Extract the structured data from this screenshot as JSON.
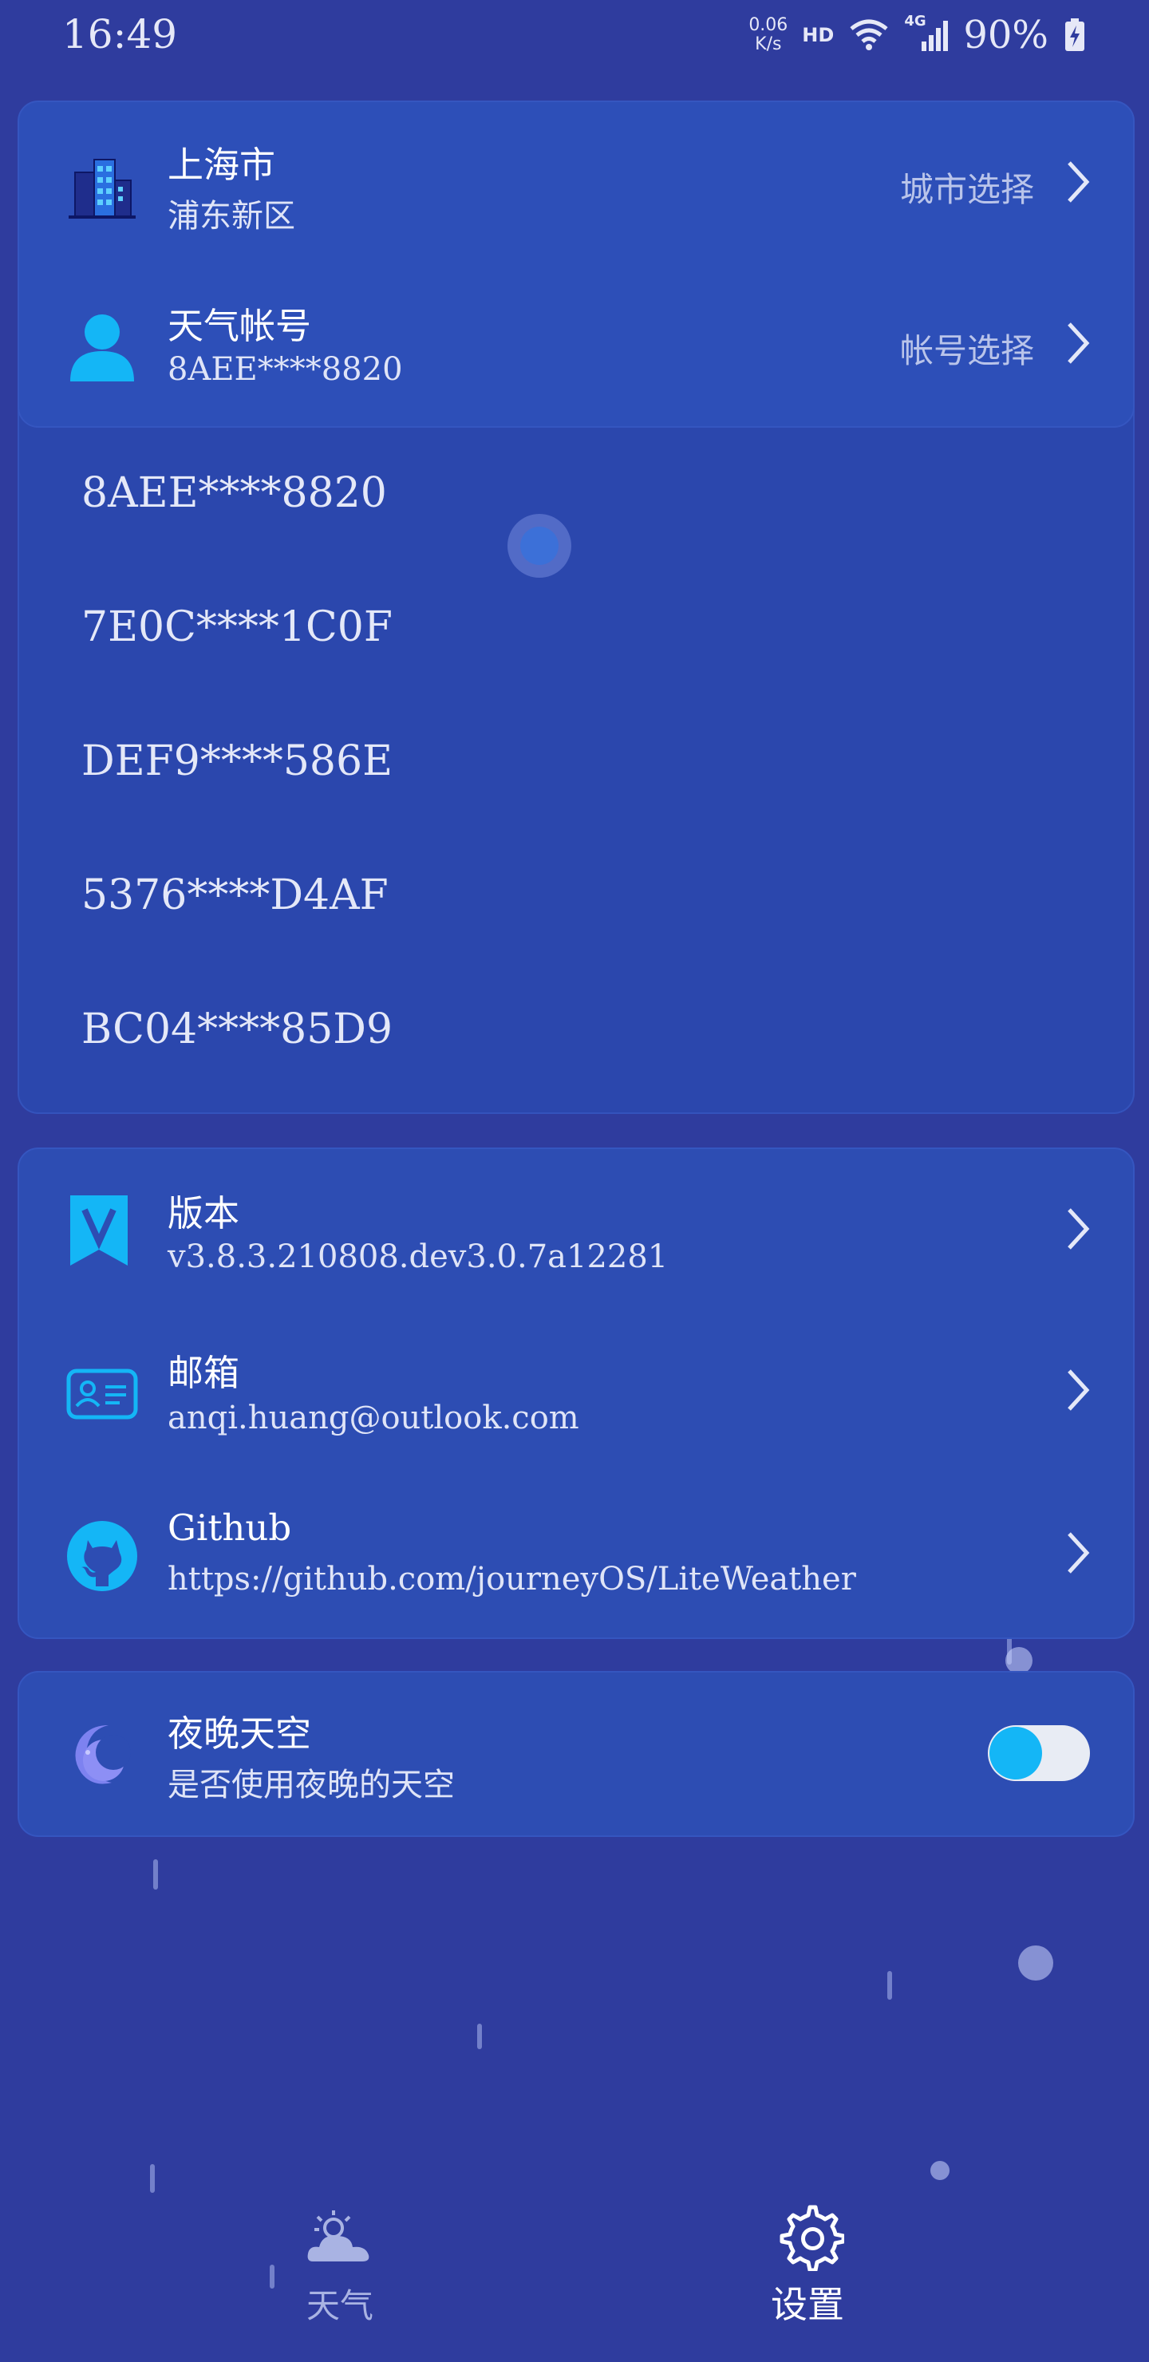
{
  "status_bar": {
    "time": "16:49",
    "net_speed_value": "0.06",
    "net_speed_unit": "K/s",
    "hd": "HD",
    "network": "4G",
    "battery": "90%"
  },
  "location": {
    "city": "上海市",
    "district": "浦东新区",
    "action": "城市选择",
    "icon": "city-buildings-icon"
  },
  "account": {
    "title": "天气帐号",
    "current": "8AEE****8820",
    "action": "帐号选择",
    "icon": "user-icon"
  },
  "account_options": [
    "8AEE****8820",
    "7E0C****1C0F",
    "DEF9****586E",
    "5376****D4AF",
    "BC04****85D9"
  ],
  "info": {
    "version": {
      "title": "版本",
      "value": "v3.8.3.210808.dev3.0.7a12281",
      "icon": "version-badge-icon"
    },
    "email": {
      "title": "邮箱",
      "value": "anqi.huang@outlook.com",
      "icon": "id-card-icon"
    },
    "github": {
      "title": "Github",
      "value": "https://github.com/journeyOS/LiteWeather",
      "icon": "github-icon"
    }
  },
  "night_sky": {
    "title": "夜晚天空",
    "subtitle": "是否使用夜晚的天空",
    "enabled": true,
    "icon": "moon-icon"
  },
  "bottom_nav": {
    "weather": "天气",
    "settings": "设置",
    "active": "settings"
  },
  "colors": {
    "background": "#2f3c9e",
    "card": "#2d4db3",
    "accent": "#14b6f6"
  }
}
